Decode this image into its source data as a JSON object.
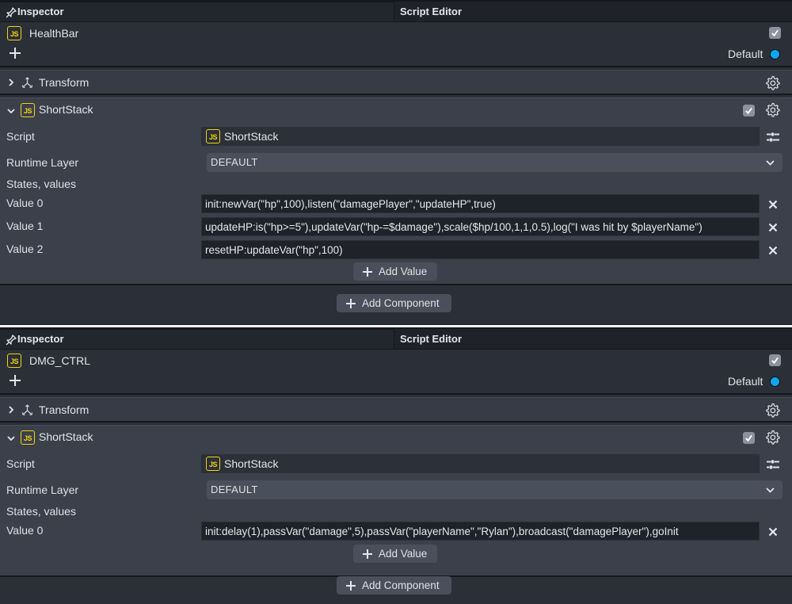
{
  "colors": {
    "js_badge": "#f1d412",
    "default_dot": "#0ea5f2",
    "panel_bg": "#2b2f37",
    "component_bg": "#3b404b",
    "field_bg": "#1f2228"
  },
  "panels": [
    {
      "header": {
        "title": "Inspector",
        "tab": "Script Editor"
      },
      "object": {
        "name": "HealthBar",
        "enabled": true,
        "layer_label": "Default"
      },
      "transform": {
        "label": "Transform",
        "expanded": false
      },
      "component": {
        "name": "ShortStack",
        "expanded": true,
        "enabled": true,
        "script_label": "Script",
        "script_value": "ShortStack",
        "runtime_label": "Runtime Layer",
        "runtime_value": "DEFAULT",
        "states_label": "States, values",
        "values": [
          {
            "label": "Value 0",
            "value": "init:newVar(\"hp\",100),listen(\"damagePlayer\",\"updateHP\",true)"
          },
          {
            "label": "Value 1",
            "value": "updateHP:is(\"hp>=5\"),updateVar(\"hp-=$damage\"),scale($hp/100,1,1,0.5),log(\"I was hit by $playerName\")"
          },
          {
            "label": "Value 2",
            "value": "resetHP:updateVar(\"hp\",100)"
          }
        ],
        "add_value_label": "Add Value"
      },
      "add_component_label": "Add Component"
    },
    {
      "header": {
        "title": "Inspector",
        "tab": "Script Editor"
      },
      "object": {
        "name": "DMG_CTRL",
        "enabled": true,
        "layer_label": "Default"
      },
      "transform": {
        "label": "Transform",
        "expanded": false
      },
      "component": {
        "name": "ShortStack",
        "expanded": true,
        "enabled": true,
        "script_label": "Script",
        "script_value": "ShortStack",
        "runtime_label": "Runtime Layer",
        "runtime_value": "DEFAULT",
        "states_label": "States, values",
        "values": [
          {
            "label": "Value 0",
            "value": "init:delay(1),passVar(\"damage\",5),passVar(\"playerName\",\"Rylan\"),broadcast(\"damagePlayer\"),goInit"
          }
        ],
        "add_value_label": "Add Value"
      },
      "add_component_label": "Add Component"
    }
  ],
  "icons": {
    "pin": "pin-icon",
    "js": "js-file-icon",
    "plus": "plus-icon",
    "check": "checkbox-checked-icon",
    "gear": "gear-icon",
    "chevron_right": "chevron-right-icon",
    "chevron_down": "chevron-down-icon",
    "axes": "transform-axes-icon",
    "sliders": "sliders-icon",
    "close": "close-icon"
  }
}
